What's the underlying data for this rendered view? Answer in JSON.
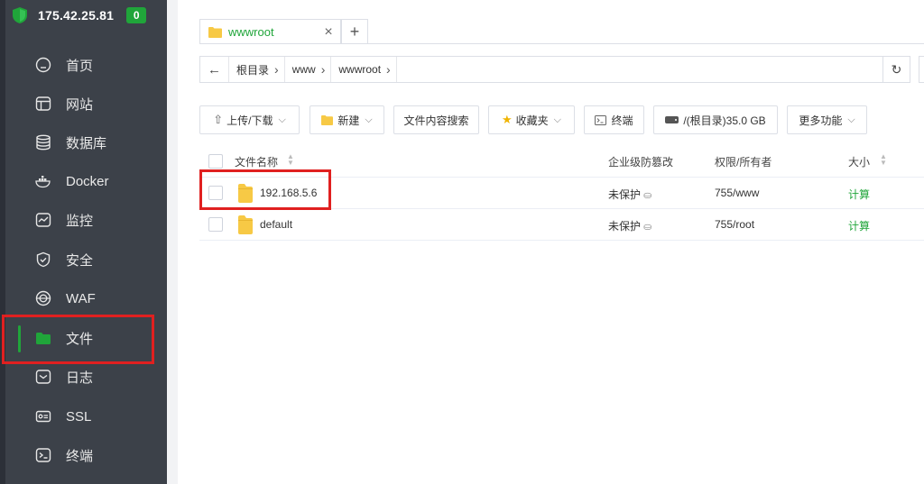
{
  "server": {
    "ip": "175.42.25.81",
    "badge": "0"
  },
  "nav": [
    {
      "label": "首页",
      "icon": "home-icon"
    },
    {
      "label": "网站",
      "icon": "website-icon"
    },
    {
      "label": "数据库",
      "icon": "database-icon"
    },
    {
      "label": "Docker",
      "icon": "docker-icon"
    },
    {
      "label": "监控",
      "icon": "monitor-icon"
    },
    {
      "label": "安全",
      "icon": "shield-icon"
    },
    {
      "label": "WAF",
      "icon": "waf-icon"
    },
    {
      "label": "文件",
      "icon": "folder-icon",
      "active": true
    },
    {
      "label": "日志",
      "icon": "log-icon"
    },
    {
      "label": "SSL",
      "icon": "ssl-icon"
    },
    {
      "label": "终端",
      "icon": "terminal-icon"
    }
  ],
  "tab": {
    "label": "wwwroot",
    "close": "×",
    "add": "+"
  },
  "path": {
    "back": "←",
    "crumbs": [
      "根目录",
      "www",
      "wwwroot"
    ],
    "refresh": "↻"
  },
  "toolbar": {
    "upload": "上传/下载",
    "new": "新建",
    "search": "文件内容搜索",
    "favorites": "收藏夹",
    "terminal": "终端",
    "disk": "/(根目录)35.0 GB",
    "more": "更多功能"
  },
  "table": {
    "headers": {
      "name": "文件名称",
      "protect": "企业级防篡改",
      "perm": "权限/所有者",
      "size": "大小"
    },
    "rows": [
      {
        "name": "192.168.5.6",
        "protect": "未保护",
        "perm": "755/www",
        "size": "计算"
      },
      {
        "name": "default",
        "protect": "未保护",
        "perm": "755/root",
        "size": "计算"
      }
    ]
  },
  "colors": {
    "accent": "#20a53a",
    "sidebar": "#3c4149",
    "highlight": "#e02020",
    "folder": "#f7c945"
  }
}
